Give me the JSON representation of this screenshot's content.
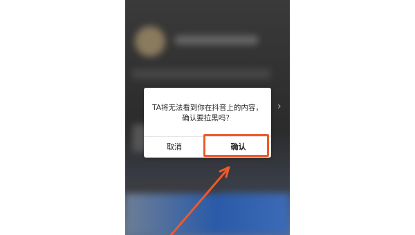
{
  "dialog": {
    "message_line1": "TA将无法看到你在抖音上的内容，",
    "message_line2": "确认要拉黑吗？",
    "cancel_label": "取消",
    "confirm_label": "确认"
  },
  "colors": {
    "annotation": "#f05a28",
    "dialog_bg": "#ffffff"
  },
  "icons": {
    "side_chevron": "chevron-right-icon"
  }
}
